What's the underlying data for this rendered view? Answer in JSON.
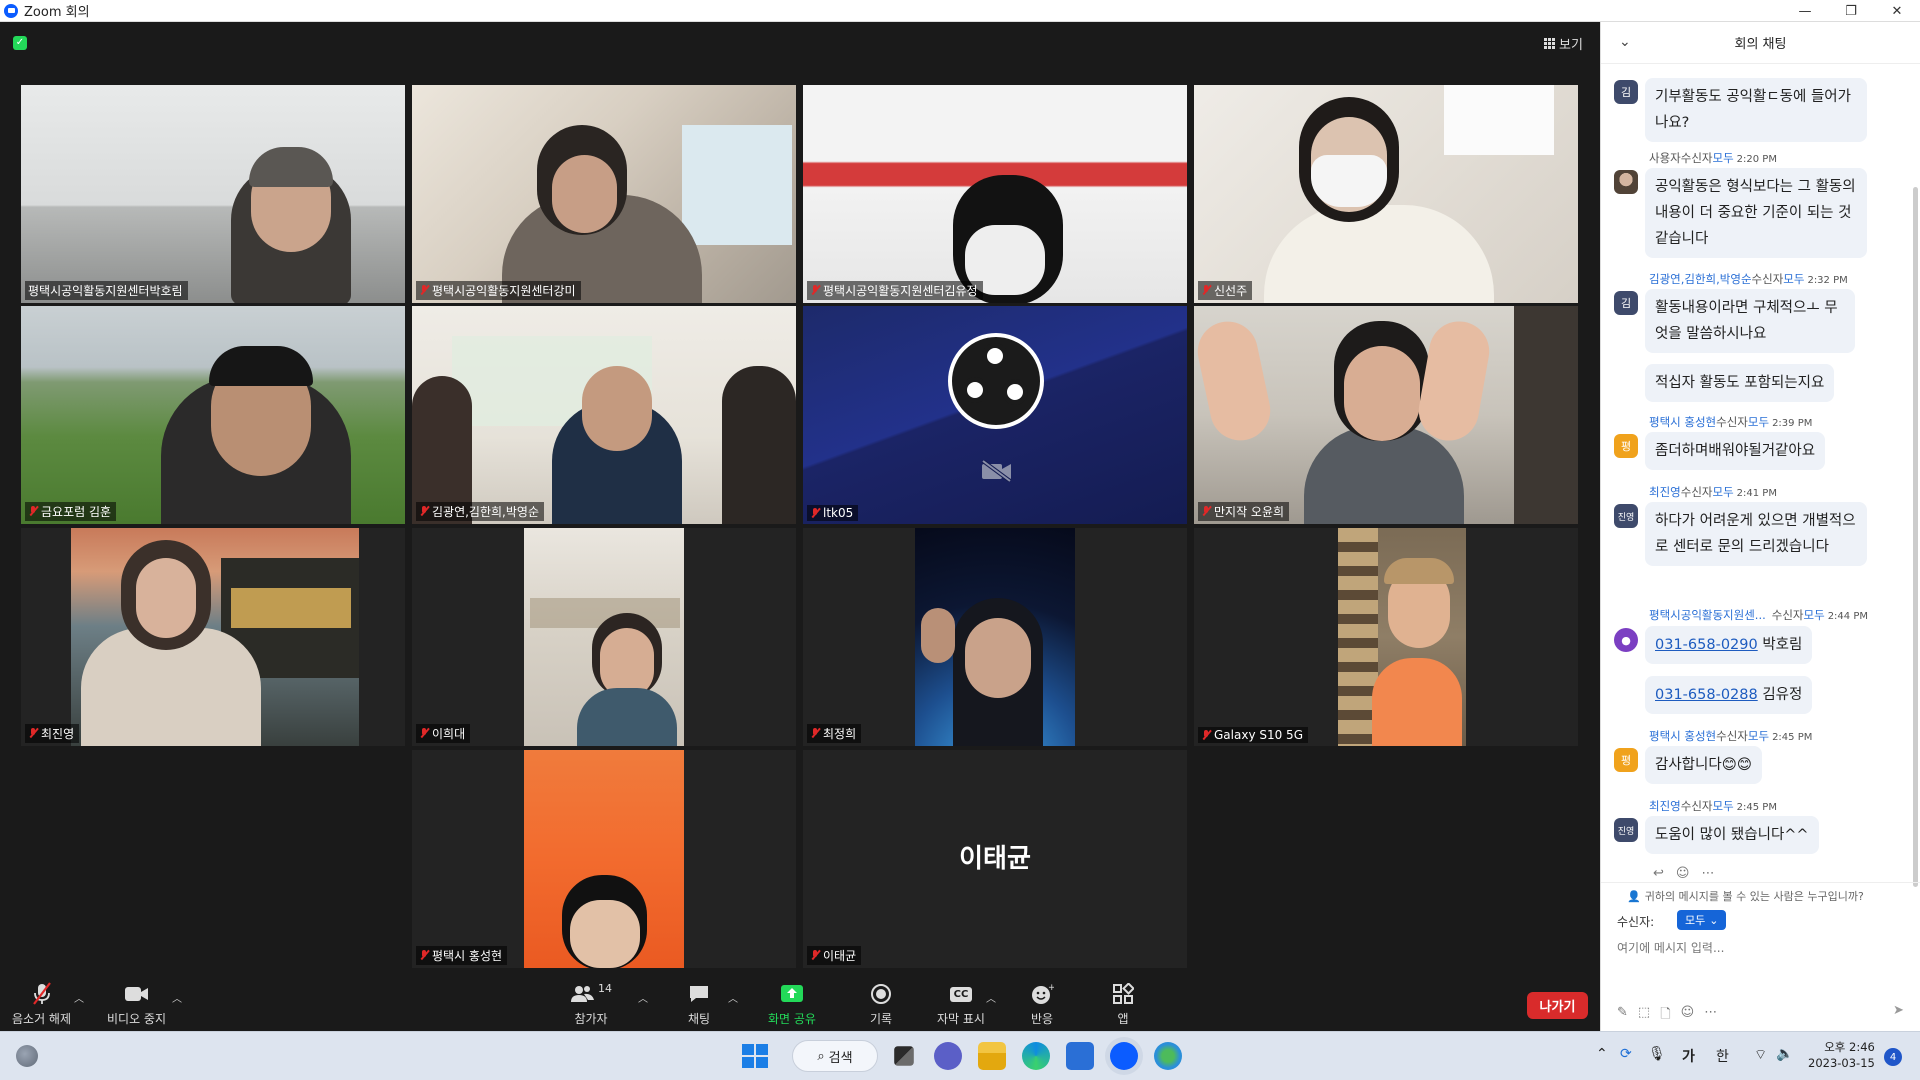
{
  "window": {
    "title": "Zoom 회의",
    "controls": [
      "minimize-icon",
      "restore-icon",
      "close-icon"
    ]
  },
  "meeting": {
    "view_label": "보기",
    "tiles": [
      {
        "name": "평택시공익활동지원센터박호림",
        "muted": false,
        "active": true
      },
      {
        "name": "평택시공익활동지원센터강미",
        "muted": true
      },
      {
        "name": "평택시공익활동지원센터김유정",
        "muted": true
      },
      {
        "name": "신선주",
        "muted": true
      },
      {
        "name": "금요포럼 김훈",
        "muted": true
      },
      {
        "name": "김광연,김한희,박영순",
        "muted": true
      },
      {
        "name": "ltk05",
        "muted": true,
        "video_off": true
      },
      {
        "name": "만지작 오윤희",
        "muted": true
      },
      {
        "name": "최진영",
        "muted": true
      },
      {
        "name": "이희대",
        "muted": true
      },
      {
        "name": "최정희",
        "muted": true
      },
      {
        "name": "Galaxy S10 5G",
        "muted": true
      },
      {
        "name": "평택시 홍성현",
        "muted": true
      },
      {
        "name": "이태균",
        "muted": true,
        "big_name": "이태균"
      }
    ]
  },
  "toolbar": {
    "unmute": "음소거 해제",
    "video_stop": "비디오 중지",
    "participants": "참가자",
    "participants_count": "14",
    "chat": "채팅",
    "share": "화면 공유",
    "record": "기록",
    "captions": "자막 표시",
    "captions_icon": "CC",
    "reactions": "반응",
    "apps": "앱",
    "leave": "나가기",
    "colors": {
      "leave": "#d92b2b",
      "share": "#23d959"
    }
  },
  "chat": {
    "title": "회의 채팅",
    "messages": [
      {
        "avatar": "김",
        "bubbles": [
          "기부활동도 공익활ㄷ동에 들어가나요?"
        ]
      },
      {
        "sender": "사용자",
        "to_label": "수신자",
        "to": "모두",
        "time": "2:20 PM",
        "avatar": "photo",
        "bubbles": [
          "공익활동은 형식보다는 그 활동의 내용이 더 중요한 기준이 되는 것 같습니다"
        ]
      },
      {
        "sender": "김광연,김한희,박영순",
        "to_label": "수신자",
        "to": "모두",
        "time": "2:32 PM",
        "avatar": "김",
        "bubbles": [
          "활동내용이라면 구체적으ㅗ 무엇을 말씀하시나요",
          "적십자 활동도 포함되는지요"
        ]
      },
      {
        "sender": "평택시 홍성현",
        "to_label": "수신자",
        "to": "모두",
        "time": "2:39 PM",
        "avatar": "평",
        "bubbles": [
          "좀더하며배워야될거같아요"
        ]
      },
      {
        "sender": "최진영",
        "to_label": "수신자",
        "to": "모두",
        "time": "2:41 PM",
        "avatar": "진영",
        "bubbles": [
          "하다가 어려운게 있으면 개별적으로 센터로 문의 드리겠습니다"
        ]
      },
      {
        "sender": "평택시공익활동지원센...",
        "to_label": "수신자",
        "to": "모두",
        "time": "2:44 PM",
        "avatar": "person",
        "bubbles": [
          {
            "link": "031-658-0290",
            "text": "박호림"
          },
          {
            "link": "031-658-0288",
            "text": "김유정"
          }
        ]
      },
      {
        "sender": "평택시 홍성현",
        "to_label": "수신자",
        "to": "모두",
        "time": "2:45 PM",
        "avatar": "평",
        "bubbles": [
          "감사합니다😊😊"
        ]
      },
      {
        "sender": "최진영",
        "to_label": "수신자",
        "to": "모두",
        "time": "2:45 PM",
        "avatar": "진영",
        "bubbles": [
          "도움이 많이 됐습니다^^"
        ]
      }
    ],
    "who_can_see": "귀하의 메시지를 볼 수 있는 사람은 누구입니까?",
    "recipient_label": "수신자:",
    "recipient_value": "모두",
    "input_placeholder": "여기에 메시지 입력..."
  },
  "taskbar": {
    "search": "검색",
    "ime_1": "가",
    "ime_2": "한",
    "time": "오후 2:46",
    "date": "2023-03-15",
    "notifications": "4"
  }
}
